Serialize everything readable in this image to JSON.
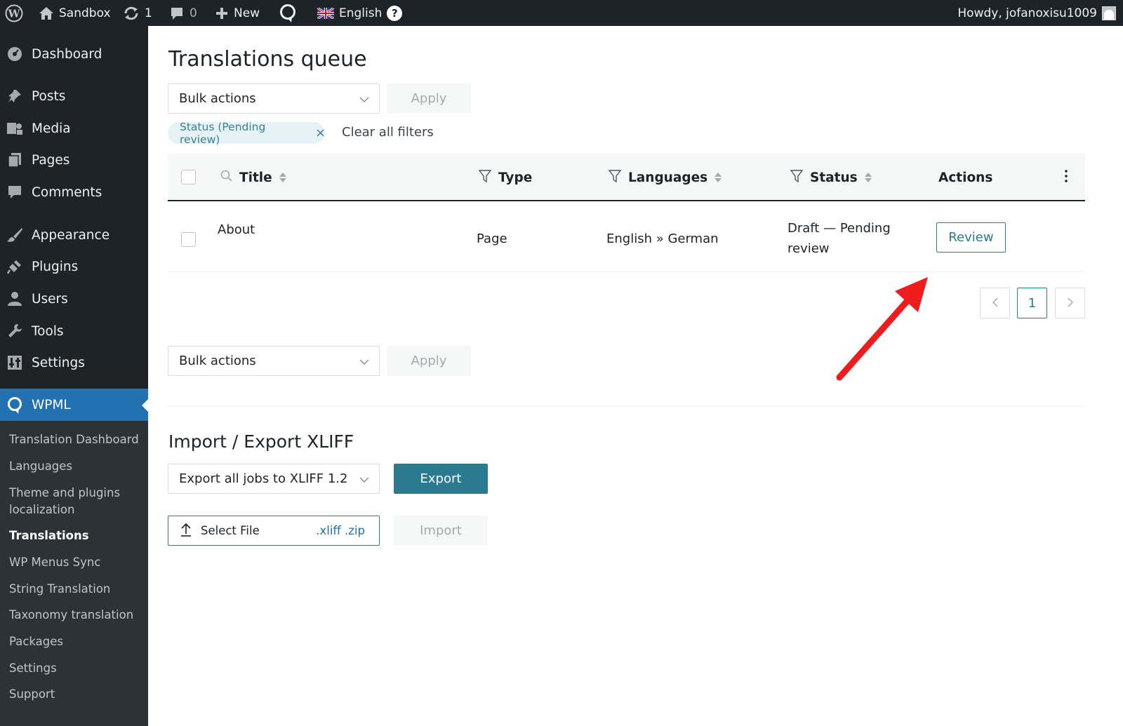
{
  "admin_bar": {
    "site_name": "Sandbox",
    "updates_count": "1",
    "comments_count": "0",
    "new_label": "New",
    "language": "English",
    "help_symbol": "?",
    "greeting": "Howdy, jofanoxisu1009"
  },
  "sidebar": {
    "items": [
      {
        "label": "Dashboard",
        "icon": "dashboard-icon"
      },
      {
        "label": "Posts",
        "icon": "pin-icon"
      },
      {
        "label": "Media",
        "icon": "media-icon"
      },
      {
        "label": "Pages",
        "icon": "pages-icon"
      },
      {
        "label": "Comments",
        "icon": "comment-icon"
      },
      {
        "label": "Appearance",
        "icon": "brush-icon"
      },
      {
        "label": "Plugins",
        "icon": "plugin-icon"
      },
      {
        "label": "Users",
        "icon": "user-icon"
      },
      {
        "label": "Tools",
        "icon": "wrench-icon"
      },
      {
        "label": "Settings",
        "icon": "settings-icon"
      },
      {
        "label": "WPML",
        "icon": "wpml-icon"
      }
    ],
    "submenu": [
      {
        "label": "Translation Dashboard"
      },
      {
        "label": "Languages"
      },
      {
        "label": "Theme and plugins localization"
      },
      {
        "label": "Translations"
      },
      {
        "label": "WP Menus Sync"
      },
      {
        "label": "String Translation"
      },
      {
        "label": "Taxonomy translation"
      },
      {
        "label": "Packages"
      },
      {
        "label": "Settings"
      },
      {
        "label": "Support"
      }
    ]
  },
  "main": {
    "title": "Translations queue",
    "bulk_actions_label": "Bulk actions",
    "apply_label": "Apply",
    "filter_chip": "Status (Pending review)",
    "clear_filters": "Clear all filters",
    "table": {
      "headers": {
        "title": "Title",
        "type": "Type",
        "languages": "Languages",
        "status": "Status",
        "actions": "Actions"
      },
      "rows": [
        {
          "title": "About",
          "type": "Page",
          "languages": "English » German",
          "status_line1": "Draft — Pending",
          "status_line2": "review",
          "action": "Review"
        }
      ]
    },
    "pagination": {
      "current_page": "1"
    },
    "xliff": {
      "title": "Import / Export XLIFF",
      "export_select": "Export all jobs to XLIFF 1.2",
      "export_button": "Export",
      "select_file": "Select File",
      "file_types": ".xliff .zip",
      "import_button": "Import"
    }
  },
  "colors": {
    "adminbar_bg": "#1d2327",
    "sidebar_bg": "#1d2327",
    "submenu_bg": "#2c3338",
    "wp_blue": "#2271b1",
    "wpml_teal": "#2c7a92",
    "annotation_red": "#ee1c1c"
  }
}
